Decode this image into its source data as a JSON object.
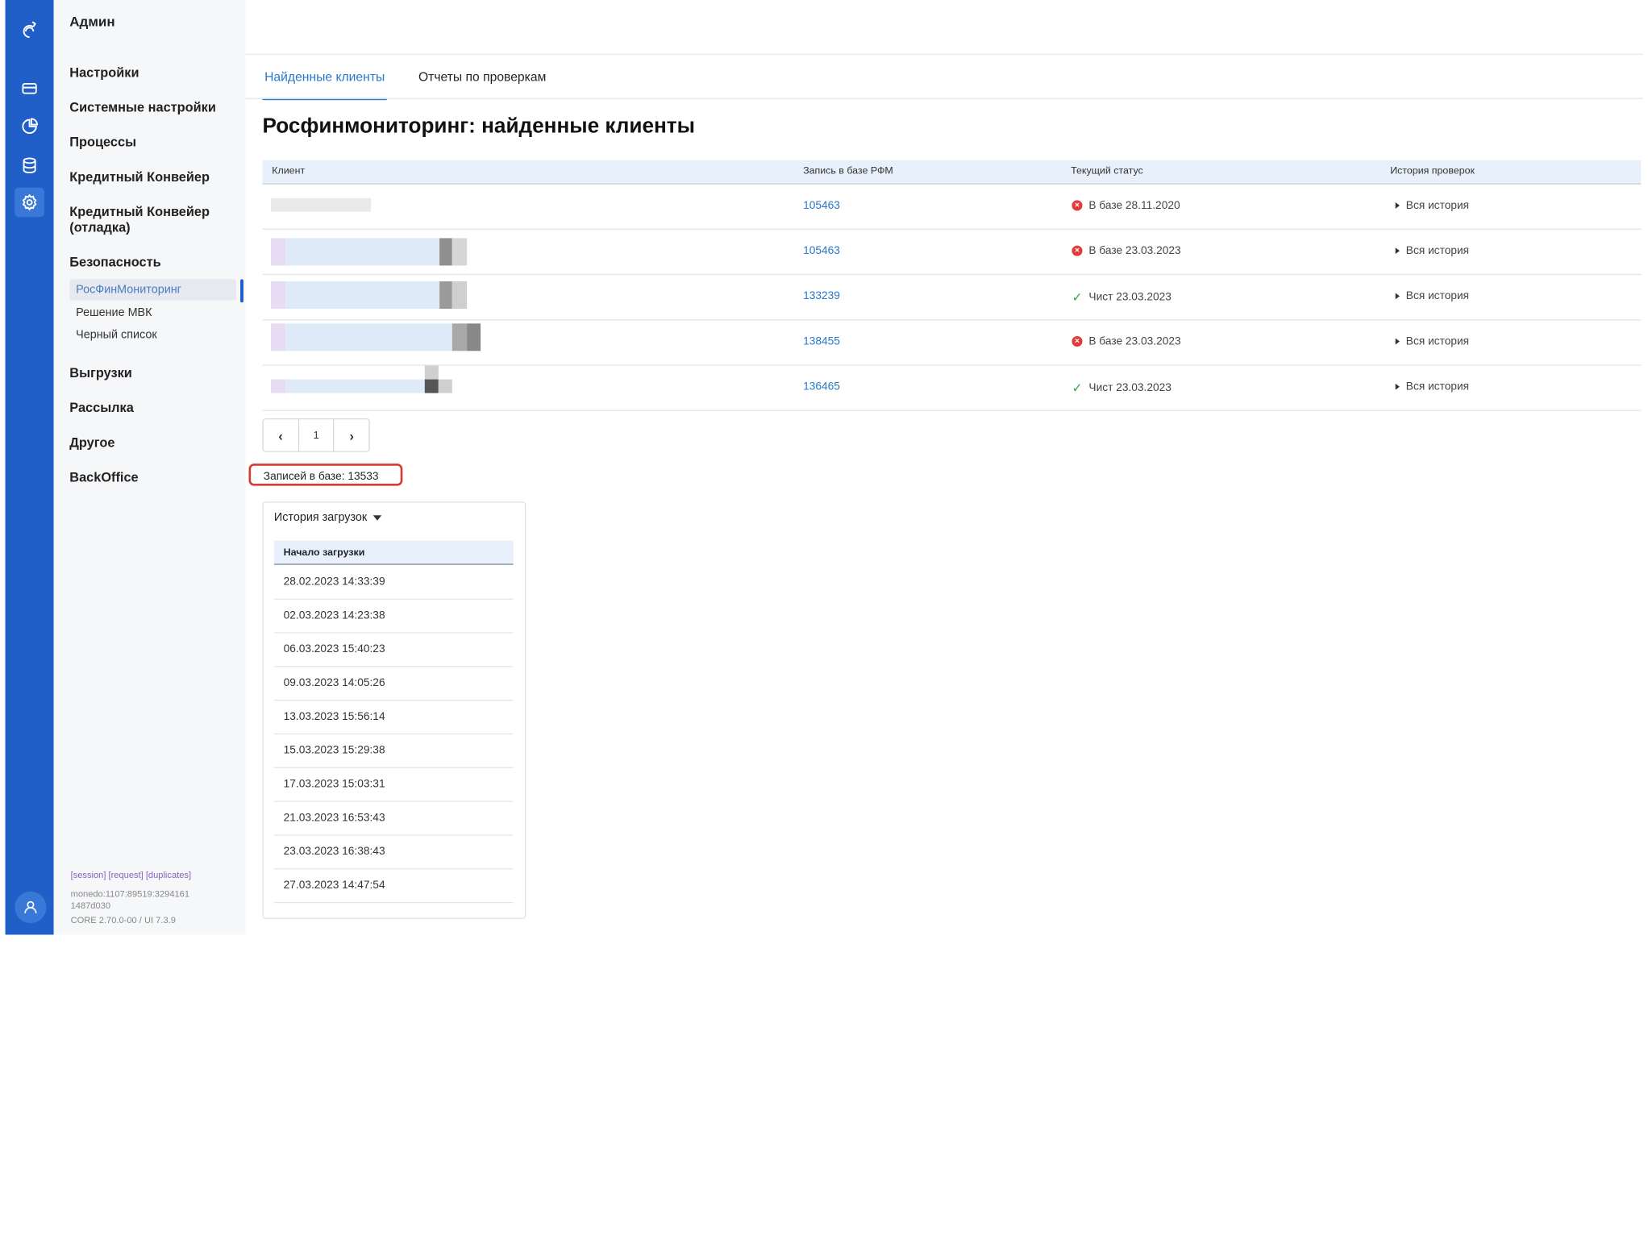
{
  "rail": {
    "icons": [
      "logo-icon",
      "card-icon",
      "pie-chart-icon",
      "database-icon",
      "settings-icon"
    ],
    "user_icon": "user-icon",
    "accent": "#1f5fc7"
  },
  "sidebar": {
    "title": "Админ",
    "items": [
      {
        "label": "Настройки"
      },
      {
        "label": "Системные настройки"
      },
      {
        "label": "Процессы"
      },
      {
        "label": "Кредитный Конвейер"
      },
      {
        "label": "Кредитный Конвейер (отладка)"
      },
      {
        "label": "Безопасность"
      }
    ],
    "subitems": [
      {
        "label": "РосФинМониторинг",
        "active": true
      },
      {
        "label": "Решение МВК"
      },
      {
        "label": "Черный список"
      }
    ],
    "items_after": [
      {
        "label": "Выгрузки"
      },
      {
        "label": "Рассылка"
      },
      {
        "label": "Другое"
      },
      {
        "label": "BackOffice"
      }
    ],
    "footer": {
      "links": "[session] [request] [duplicates]",
      "session_line1": "monedo:1107:89519:3294161",
      "session_line2": "1487d030",
      "version": "CORE 2.70.0-00 / UI 7.3.9"
    }
  },
  "tabs": [
    {
      "label": "Найденные клиенты",
      "active": true
    },
    {
      "label": "Отчеты по проверкам",
      "active": false
    }
  ],
  "page_title": "Росфинмониторинг: найденные клиенты",
  "table": {
    "headers": [
      "Клиент",
      "Запись в базе РФМ",
      "Текущий статус",
      "История проверок"
    ],
    "rows": [
      {
        "rfm": "105463",
        "status": "В базе 28.11.2020",
        "status_type": "error",
        "history": "Вся история"
      },
      {
        "rfm": "105463",
        "status": "В базе 23.03.2023",
        "status_type": "error",
        "history": "Вся история"
      },
      {
        "rfm": "133239",
        "status": "Чист 23.03.2023",
        "status_type": "ok",
        "history": "Вся история"
      },
      {
        "rfm": "138455",
        "status": "В базе 23.03.2023",
        "status_type": "error",
        "history": "Вся история"
      },
      {
        "rfm": "136465",
        "status": "Чист 23.03.2023",
        "status_type": "ok",
        "history": "Вся история"
      }
    ]
  },
  "pagination": {
    "prev": "‹",
    "page": "1",
    "next": "›"
  },
  "records_count": "Записей в базе: 13533",
  "upload_history": {
    "title": "История загрузок",
    "column": "Начало загрузки",
    "rows": [
      "28.02.2023 14:33:39",
      "02.03.2023 14:23:38",
      "06.03.2023 15:40:23",
      "09.03.2023 14:05:26",
      "13.03.2023 15:56:14",
      "15.03.2023 15:29:38",
      "17.03.2023 15:03:31",
      "21.03.2023 16:53:43",
      "23.03.2023 16:38:43",
      "27.03.2023 14:47:54"
    ]
  }
}
